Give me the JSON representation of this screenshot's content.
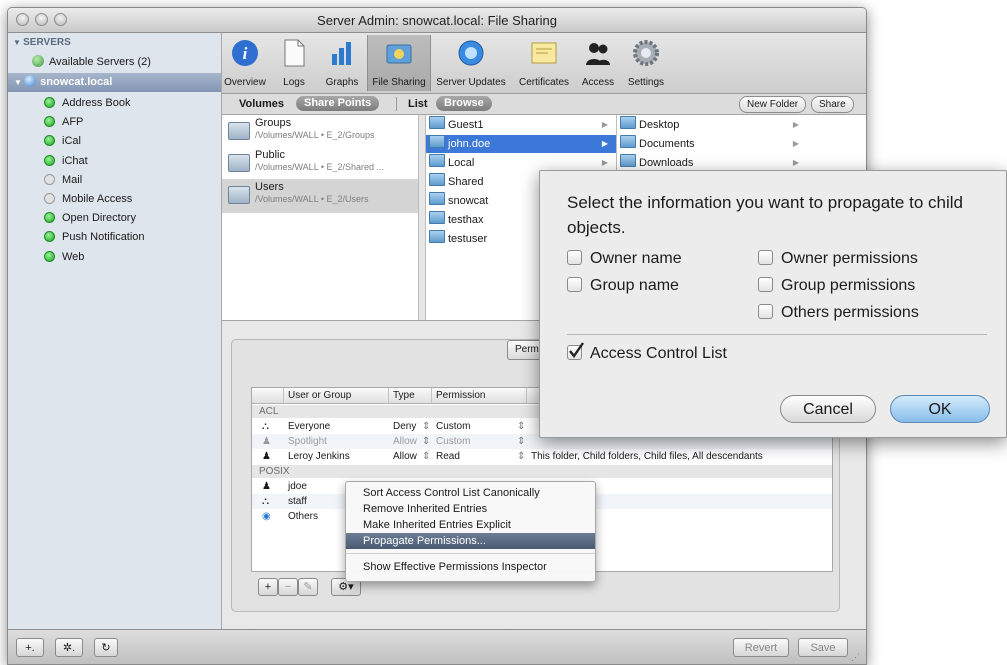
{
  "window": {
    "title": "Server Admin: snowcat.local: File Sharing"
  },
  "sidebar": {
    "header": "SERVERS",
    "available": "Available Servers (2)",
    "server": "snowcat.local",
    "services": [
      {
        "label": "Address Book",
        "status": "on"
      },
      {
        "label": "AFP",
        "status": "on"
      },
      {
        "label": "iCal",
        "status": "on"
      },
      {
        "label": "iChat",
        "status": "on"
      },
      {
        "label": "Mail",
        "status": "off"
      },
      {
        "label": "Mobile Access",
        "status": "off"
      },
      {
        "label": "Open Directory",
        "status": "on"
      },
      {
        "label": "Push Notification",
        "status": "on"
      },
      {
        "label": "Web",
        "status": "on"
      }
    ]
  },
  "toolbar": {
    "items": [
      {
        "label": "Overview",
        "icon": "info-icon"
      },
      {
        "label": "Logs",
        "icon": "document-icon"
      },
      {
        "label": "Graphs",
        "icon": "bar-graph-icon"
      },
      {
        "label": "File Sharing",
        "icon": "shared-folder-icon"
      },
      {
        "label": "Server Updates",
        "icon": "update-globe-icon"
      },
      {
        "label": "Certificates",
        "icon": "certificate-icon"
      },
      {
        "label": "Access",
        "icon": "users-icon"
      },
      {
        "label": "Settings",
        "icon": "gear-icon"
      }
    ]
  },
  "subbar": {
    "volumes": "Volumes",
    "share_points": "Share Points",
    "list": "List",
    "browse": "Browse",
    "new_folder": "New Folder",
    "share": "Share"
  },
  "volumes": [
    {
      "name": "Groups",
      "path": "/Volumes/WALL • E_2/Groups"
    },
    {
      "name": "Public",
      "path": "/Volumes/WALL • E_2/Shared ..."
    },
    {
      "name": "Users",
      "path": "/Volumes/WALL • E_2/Users"
    }
  ],
  "users_column": [
    "Guest1",
    "john.doe",
    "Local",
    "Shared",
    "snowcat",
    "testhax",
    "testuser"
  ],
  "home_column": [
    "Desktop",
    "Documents",
    "Downloads"
  ],
  "permissions": {
    "tab_fragment": "Perm",
    "headers": {
      "user_or_group": "User or Group",
      "type": "Type",
      "permission": "Permission"
    },
    "acl_label": "ACL",
    "posix_label": "POSIX",
    "acl_rows": [
      {
        "name": "Everyone",
        "type": "Deny",
        "permission": "Custom",
        "applies": "",
        "dim": false
      },
      {
        "name": "Spotlight",
        "type": "Allow",
        "permission": "Custom",
        "applies": "",
        "dim": true
      },
      {
        "name": "Leroy Jenkins",
        "type": "Allow",
        "permission": "Read",
        "applies": "This folder, Child folders, Child files, All descendants",
        "dim": false
      }
    ],
    "posix_rows": [
      {
        "name": "jdoe"
      },
      {
        "name": "staff"
      },
      {
        "name": "Others"
      }
    ],
    "bottom_buttons": {
      "add": "+",
      "remove": "−",
      "edit": "✎",
      "gear": "⚙▾"
    }
  },
  "context_menu": {
    "items": [
      "Sort Access Control List Canonically",
      "Remove Inherited Entries",
      "Make Inherited Entries Explicit",
      "Propagate Permissions...",
      "Show Effective Permissions Inspector"
    ],
    "selected_index": 3
  },
  "dialog": {
    "prompt": "Select the information you want to propagate to child objects.",
    "options": {
      "owner_name": {
        "label": "Owner name",
        "checked": false
      },
      "group_name": {
        "label": "Group name",
        "checked": false
      },
      "owner_permissions": {
        "label": "Owner permissions",
        "checked": false
      },
      "group_permissions": {
        "label": "Group permissions",
        "checked": false
      },
      "others_permissions": {
        "label": "Others permissions",
        "checked": false
      },
      "acl": {
        "label": "Access Control List",
        "checked": true
      }
    },
    "cancel": "Cancel",
    "ok": "OK"
  },
  "footer": {
    "add": "+.",
    "gear": "✲.",
    "refresh": "↻",
    "revert": "Revert",
    "save": "Save"
  },
  "colors": {
    "selection_blue": "#3b78d8",
    "sidebar_bg": "#dfe5ec",
    "status_green": "#18a81c",
    "ok_button": "#9ccbf0"
  }
}
